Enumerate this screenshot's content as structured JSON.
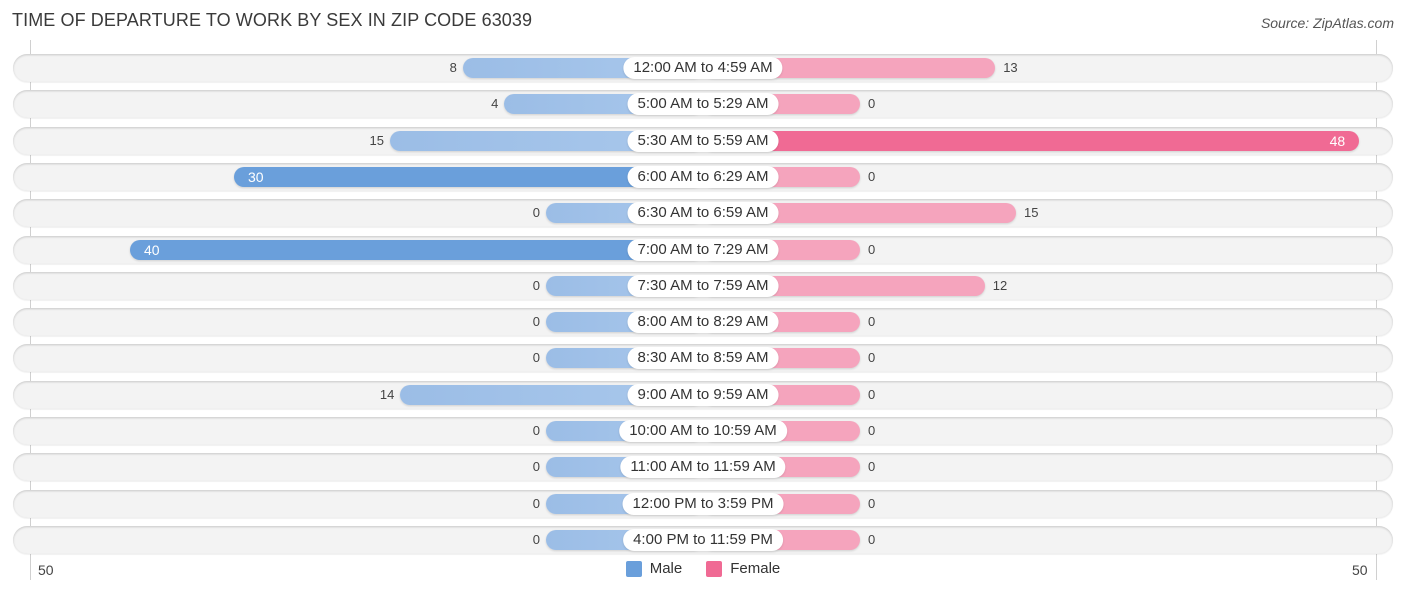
{
  "title": "TIME OF DEPARTURE TO WORK BY SEX IN ZIP CODE 63039",
  "source": "Source: ZipAtlas.com",
  "colors": {
    "male": "#6a9fdb",
    "male_light": "#a9c8ec",
    "female": "#f06a94",
    "female_light": "#f5a4bd"
  },
  "chart_data": {
    "type": "bar",
    "orientation": "horizontal-diverging",
    "title": "TIME OF DEPARTURE TO WORK BY SEX IN ZIP CODE 63039",
    "xlabel": "",
    "ylabel": "",
    "xlim": [
      -50,
      50
    ],
    "tick_labels": {
      "left": "50",
      "right": "50"
    },
    "legend": {
      "position": "bottom-center",
      "entries": [
        "Male",
        "Female"
      ]
    },
    "grid": false,
    "categories": [
      "12:00 AM to 4:59 AM",
      "5:00 AM to 5:29 AM",
      "5:30 AM to 5:59 AM",
      "6:00 AM to 6:29 AM",
      "6:30 AM to 6:59 AM",
      "7:00 AM to 7:29 AM",
      "7:30 AM to 7:59 AM",
      "8:00 AM to 8:29 AM",
      "8:30 AM to 8:59 AM",
      "9:00 AM to 9:59 AM",
      "10:00 AM to 10:59 AM",
      "11:00 AM to 11:59 AM",
      "12:00 PM to 3:59 PM",
      "4:00 PM to 11:59 PM"
    ],
    "series": [
      {
        "name": "Male",
        "values": [
          8,
          4,
          15,
          30,
          0,
          40,
          0,
          0,
          0,
          14,
          0,
          0,
          0,
          0
        ]
      },
      {
        "name": "Female",
        "values": [
          13,
          0,
          48,
          0,
          15,
          0,
          12,
          0,
          0,
          0,
          0,
          0,
          0,
          0
        ]
      }
    ]
  }
}
